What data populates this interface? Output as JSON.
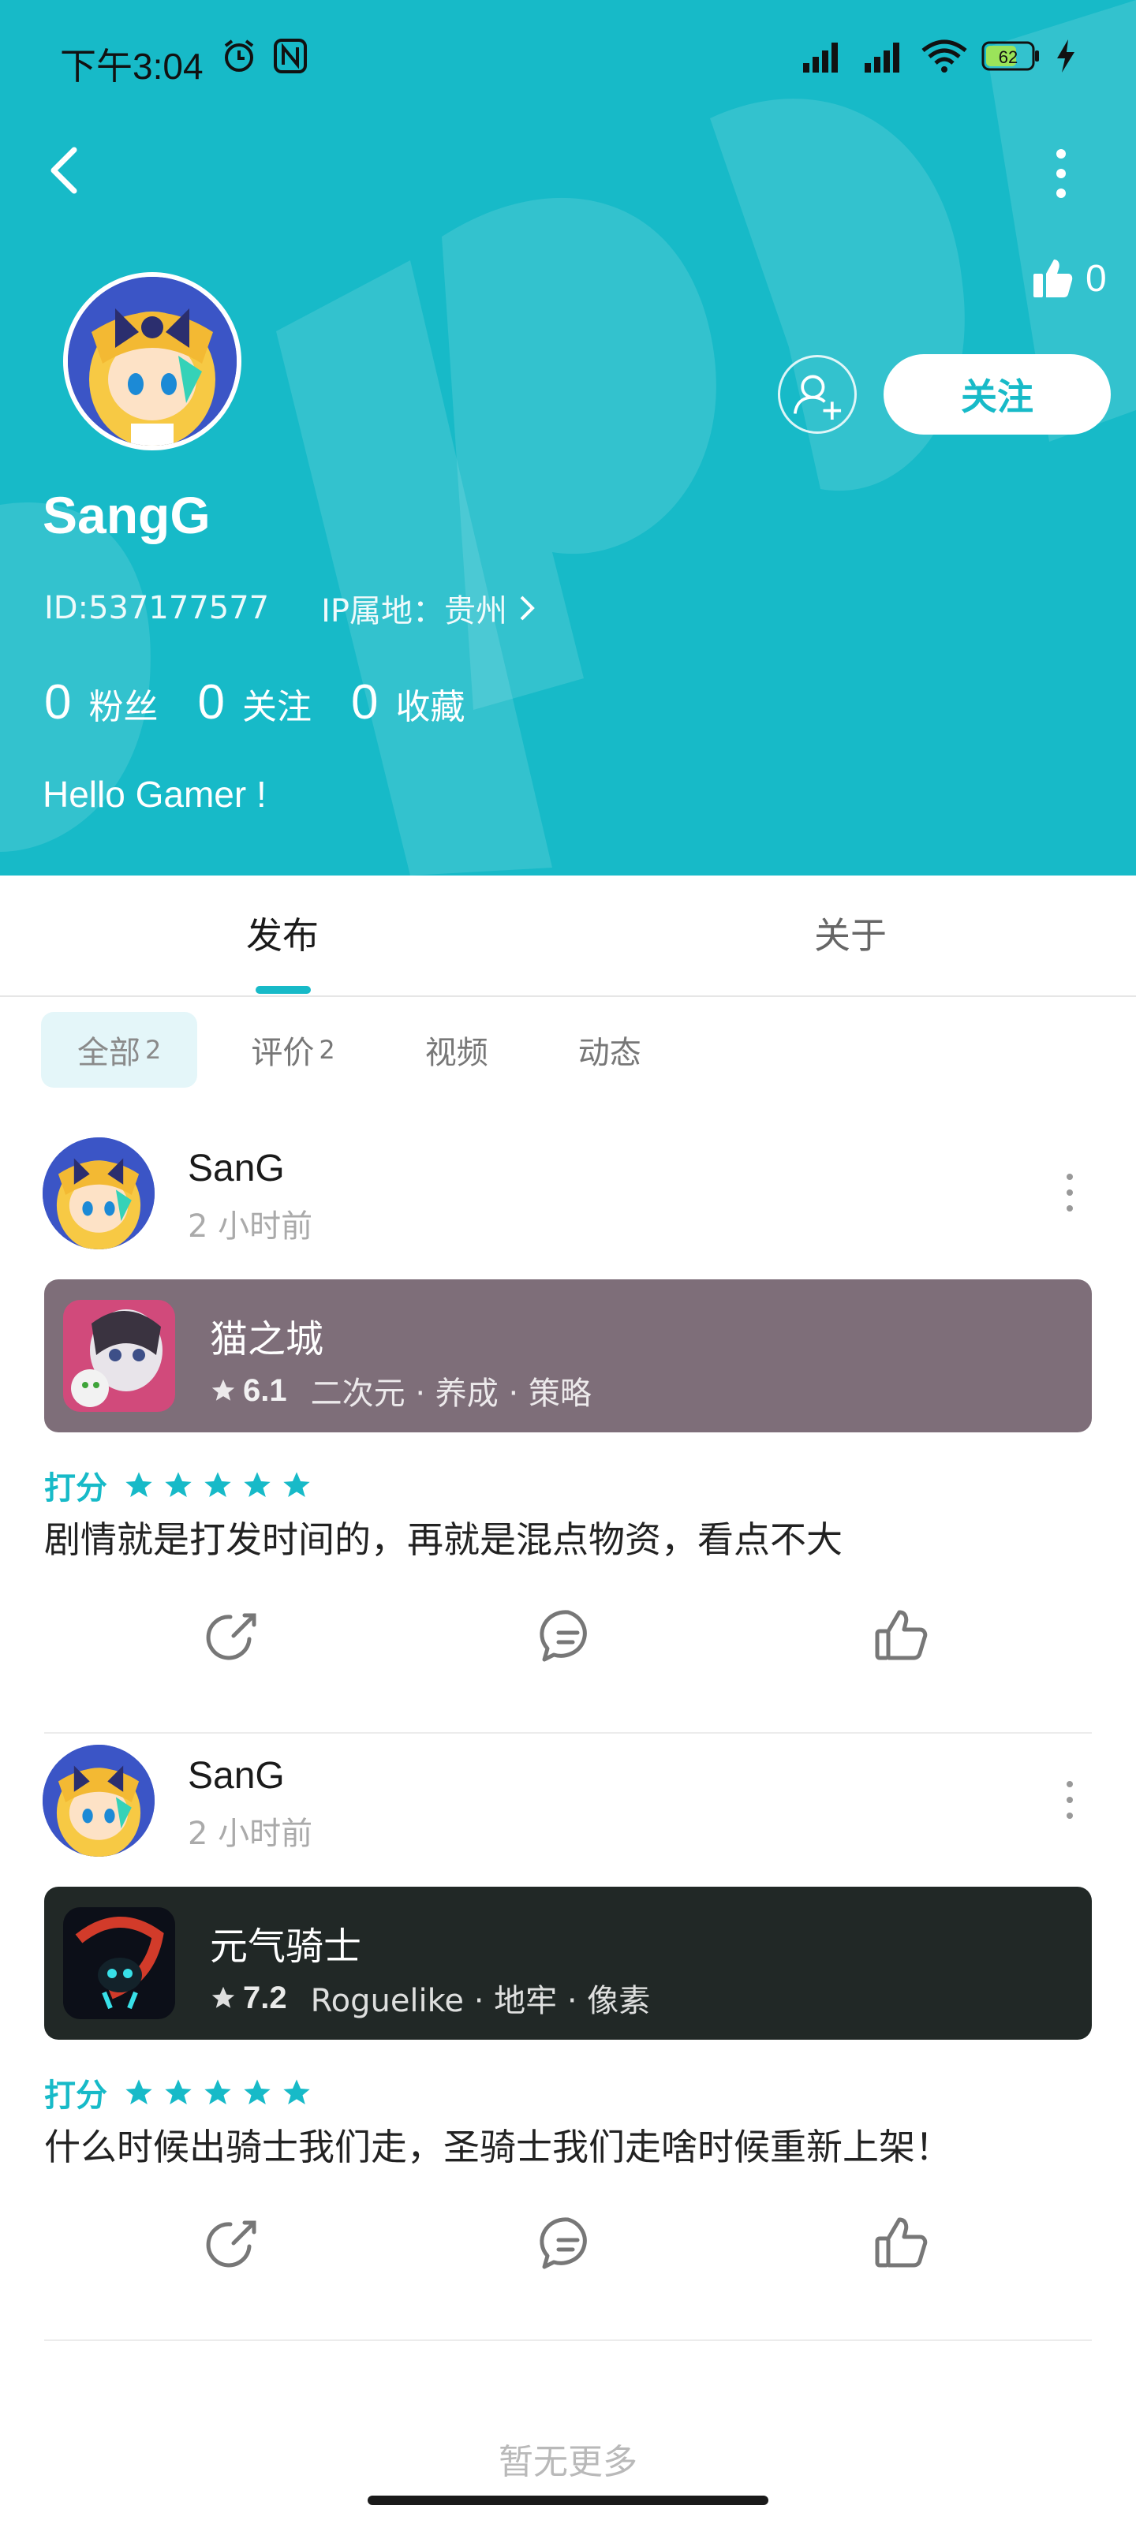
{
  "status_bar": {
    "time": "下午3:04",
    "battery": "62"
  },
  "header": {
    "likes_count": "0",
    "follow_label": "关注",
    "username": "SangG",
    "user_id": "ID:537177577",
    "ip_location": "IP属地：贵州",
    "stats": [
      {
        "num": "0",
        "label": "粉丝"
      },
      {
        "num": "0",
        "label": "关注"
      },
      {
        "num": "0",
        "label": "收藏"
      }
    ],
    "bio": "Hello Gamer !"
  },
  "tabs": [
    {
      "label": "发布"
    },
    {
      "label": "关于"
    }
  ],
  "filters": [
    {
      "label": "全部",
      "count": "2"
    },
    {
      "label": "评价",
      "count": "2"
    },
    {
      "label": "视频",
      "count": ""
    },
    {
      "label": "动态",
      "count": ""
    }
  ],
  "posts": [
    {
      "author": "SanG",
      "time": "2 小时前",
      "game": {
        "name": "猫之城",
        "score": "6.1",
        "tags": "二次元 · 养成 · 策略"
      },
      "rating_label": "打分",
      "stars": 5,
      "text": "剧情就是打发时间的，再就是混点物资，看点不大"
    },
    {
      "author": "SanG",
      "time": "2 小时前",
      "game": {
        "name": "元气骑士",
        "score": "7.2",
        "tags": "Roguelike · 地牢 · 像素"
      },
      "rating_label": "打分",
      "stars": 5,
      "text": "什么时候出骑士我们走，圣骑士我们走啥时候重新上架！"
    }
  ],
  "footer": {
    "end_text": "暂无更多"
  },
  "colors": {
    "accent": "#17bac8",
    "card1": "#7e6e79",
    "card2": "#212826"
  }
}
